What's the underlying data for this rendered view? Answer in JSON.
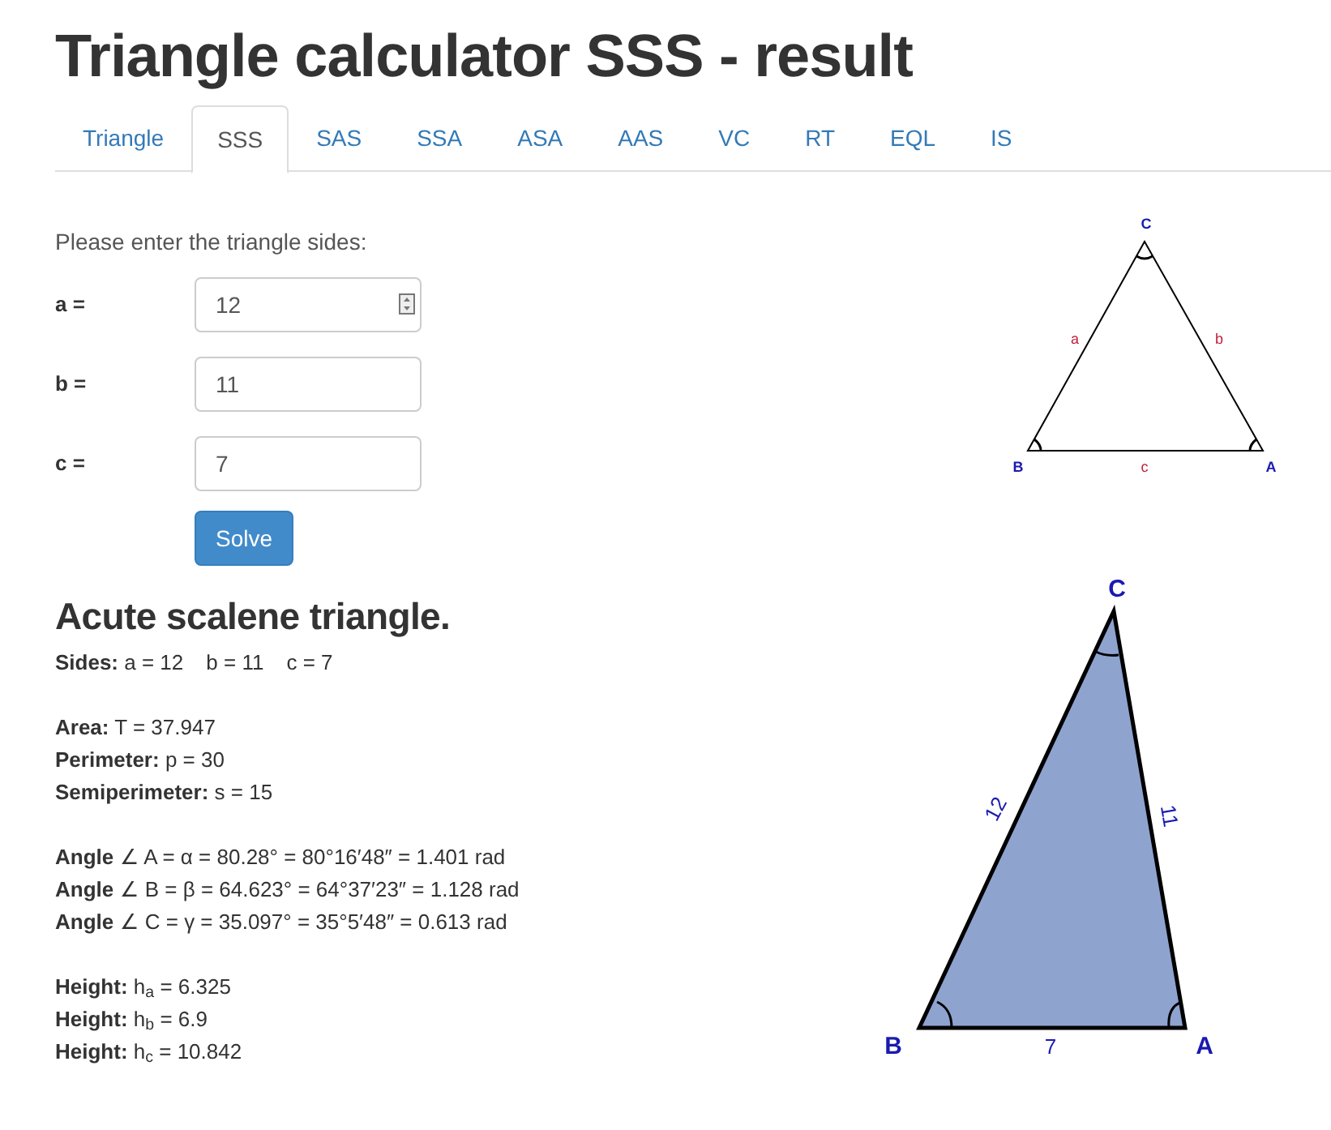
{
  "title": "Triangle calculator SSS - result",
  "tabs": [
    {
      "label": "Triangle",
      "selected": false
    },
    {
      "label": "SSS",
      "selected": true
    },
    {
      "label": "SAS",
      "selected": false
    },
    {
      "label": "SSA",
      "selected": false
    },
    {
      "label": "ASA",
      "selected": false
    },
    {
      "label": "AAS",
      "selected": false
    },
    {
      "label": "VC",
      "selected": false
    },
    {
      "label": "RT",
      "selected": false
    },
    {
      "label": "EQL",
      "selected": false
    },
    {
      "label": "IS",
      "selected": false
    }
  ],
  "form": {
    "prompt": "Please enter the triangle sides:",
    "fields": [
      {
        "label": "a =",
        "value": "12",
        "spinner": true
      },
      {
        "label": "b =",
        "value": "11",
        "spinner": false
      },
      {
        "label": "c =",
        "value": "7",
        "spinner": false
      }
    ],
    "button": "Solve"
  },
  "small_diagram": {
    "vertices": [
      "C",
      "B",
      "A"
    ],
    "sides": [
      "a",
      "b",
      "c"
    ]
  },
  "result": {
    "heading": "Acute scalene triangle.",
    "groups": [
      [
        {
          "label": "Sides:",
          "values": [
            "a = 12",
            "b = 11",
            "c = 7"
          ]
        }
      ],
      [
        {
          "label": "Area:",
          "values": [
            "T = 37.947"
          ]
        },
        {
          "label": "Perimeter:",
          "values": [
            "p = 30"
          ]
        },
        {
          "label": "Semiperimeter:",
          "values": [
            "s = 15"
          ]
        }
      ],
      [
        {
          "label": "Angle",
          "values": [
            "∠ A = α = 80.28° = 80°16′48″ = 1.401 rad"
          ]
        },
        {
          "label": "Angle",
          "values": [
            "∠ B = β = 64.623° = 64°37′23″ = 1.128 rad"
          ]
        },
        {
          "label": "Angle",
          "values": [
            "∠ C = γ = 35.097° = 35°5′48″ = 0.613 rad"
          ]
        }
      ],
      [
        {
          "label": "Height:",
          "values": [
            "h$_{a}$ = 6.325"
          ]
        },
        {
          "label": "Height:",
          "values": [
            "h$_{b}$ = 6.9"
          ]
        },
        {
          "label": "Height:",
          "values": [
            "h$_{c}$ = 10.842"
          ]
        }
      ]
    ]
  },
  "large_diagram": {
    "vertices": [
      "C",
      "B",
      "A"
    ],
    "sides": [
      "12",
      "11",
      "7"
    ]
  }
}
